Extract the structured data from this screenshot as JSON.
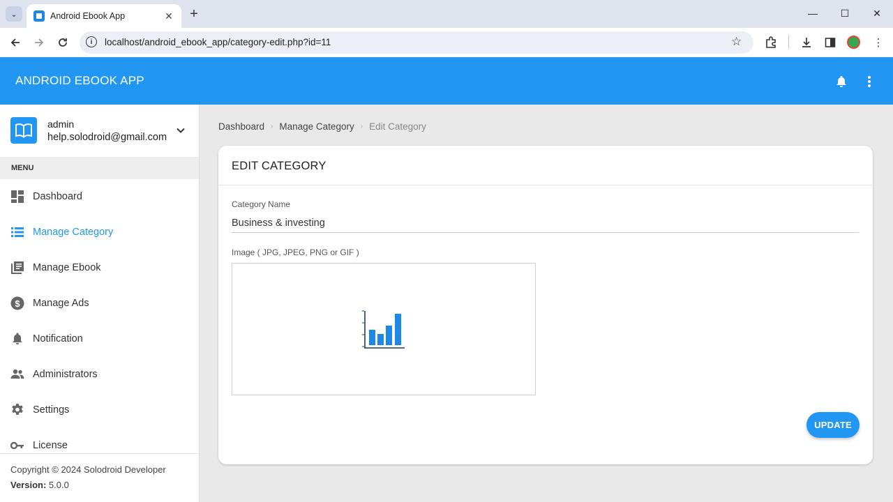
{
  "browser": {
    "tab_title": "Android Ebook App",
    "tab_close": "✕",
    "new_tab": "+",
    "url": "localhost/android_ebook_app/category-edit.php?id=11",
    "window_controls": [
      "—",
      "☐",
      "✕"
    ]
  },
  "app": {
    "title": "ANDROID EBOOK APP",
    "accent_color": "#2196f3"
  },
  "user": {
    "name": "admin",
    "email": "help.solodroid@gmail.com"
  },
  "sidebar": {
    "menu_header": "MENU",
    "items": [
      {
        "label": "Dashboard",
        "icon": "dashboard-icon"
      },
      {
        "label": "Manage Category",
        "icon": "list-icon",
        "active": true
      },
      {
        "label": "Manage Ebook",
        "icon": "library-books-icon"
      },
      {
        "label": "Manage Ads",
        "icon": "dollar-icon"
      },
      {
        "label": "Notification",
        "icon": "bell-icon"
      },
      {
        "label": "Administrators",
        "icon": "people-icon"
      },
      {
        "label": "Settings",
        "icon": "gear-icon"
      },
      {
        "label": "License",
        "icon": "key-icon"
      }
    ],
    "copyright": "Copyright © 2024 Solodroid Developer",
    "version_label": "Version:",
    "version_value": "5.0.0"
  },
  "breadcrumb": {
    "items": [
      "Dashboard",
      "Manage Category",
      "Edit Category"
    ],
    "separator": "›"
  },
  "form": {
    "title": "EDIT CATEGORY",
    "name_label": "Category Name",
    "name_value": "Business & investing",
    "image_label": "Image ( JPG, JPEG, PNG or GIF )",
    "submit_label": "UPDATE"
  }
}
